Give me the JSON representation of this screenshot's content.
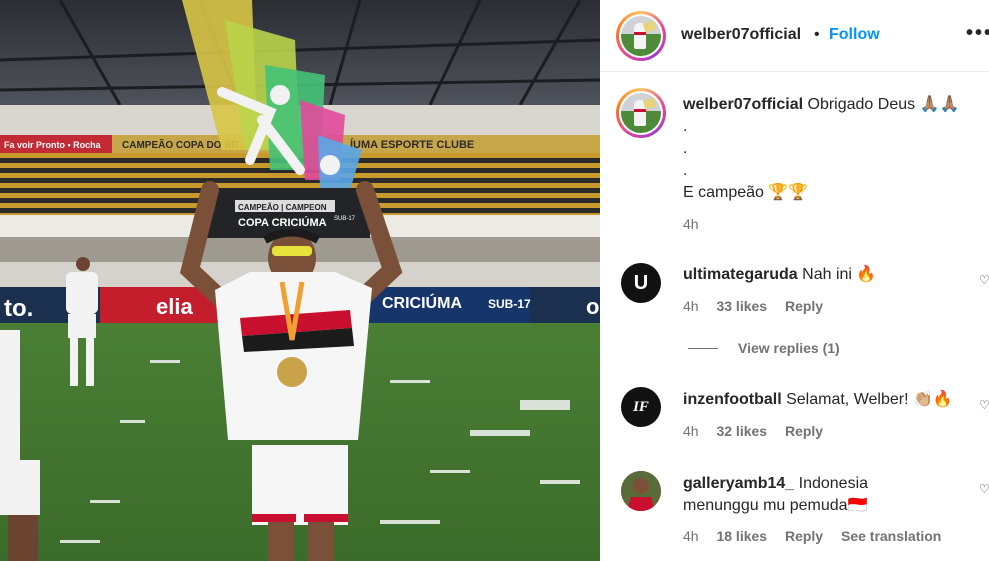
{
  "post": {
    "author": "welber07official",
    "dot": "•",
    "follow_label": "Follow",
    "more_icon": "more-options-icon",
    "photo_texts": {
      "banner_left": "Fa voir Pronto • Rocha",
      "banner_copa": "CAMPEÃO COPA DO BR",
      "banner_club": "ÍUMA ESPORTE CLUBE",
      "trophy_plate_1": "CAMPEÃO | CAMPEON",
      "trophy_plate_2": "COPA CRICIÚMA",
      "trophy_plate_sub": "SUB-17",
      "board_left": "to.",
      "board_elia": "elia",
      "board_criciuma": "CRICIÚMA",
      "board_sub17": "SUB-17",
      "board_right": "o"
    }
  },
  "caption": {
    "username": "welber07official",
    "line1": "Obrigado Deus 🙏🏽🙏🏽",
    "line2": ".",
    "line3": ".",
    "line4": ".",
    "line5": "E campeão 🏆🏆",
    "time": "4h"
  },
  "comments": [
    {
      "username": "ultimategaruda",
      "text": "Nah ini 🔥",
      "time": "4h",
      "likes": "33 likes",
      "reply_label": "Reply",
      "avatar_icon": "ultimate-garuda-logo",
      "avatar_letter": "U"
    },
    {
      "username": "inzenfootball",
      "text": "Selamat, Welber! 👏🏼🔥",
      "time": "4h",
      "likes": "32 likes",
      "reply_label": "Reply",
      "avatar_icon": "inzen-football-logo",
      "avatar_letter": "IF"
    },
    {
      "username": "galleryamb14_",
      "text": "Indonesia menunggu mu pemuda🇮🇩",
      "time": "4h",
      "likes": "18 likes",
      "reply_label": "Reply",
      "see_translation": "See translation",
      "avatar_icon": "player-photo-avatar"
    }
  ],
  "view_replies": "View replies (1)",
  "colors": {
    "follow": "#0095f6",
    "muted": "#737373",
    "text": "#262626"
  }
}
